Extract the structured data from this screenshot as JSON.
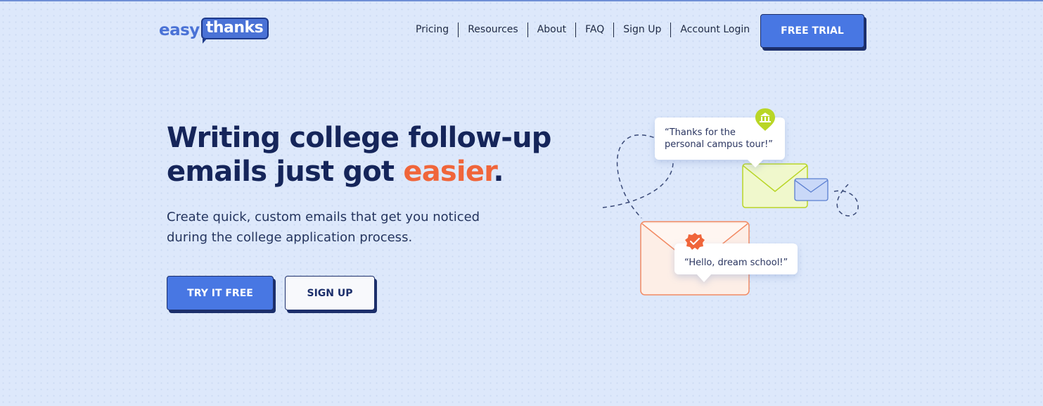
{
  "logo": {
    "part1": "easy",
    "part2": "thanks"
  },
  "nav": {
    "items": [
      "Pricing",
      "Resources",
      "About",
      "FAQ",
      "Sign Up",
      "Account Login"
    ],
    "cta_label": "FREE TRIAL"
  },
  "hero": {
    "headline_line1": "Writing college follow-up",
    "headline_line2_start": "emails just got ",
    "headline_accent": "easier",
    "headline_end": ".",
    "subtext": "Create quick, custom emails that get you noticed during the college application process.",
    "primary_button": "TRY IT FREE",
    "secondary_button": "SIGN UP"
  },
  "illustration": {
    "bubble_top_line1": "“Thanks for the",
    "bubble_top_line2": "personal campus tour!”",
    "bubble_bottom": "“Hello, dream school!”",
    "icons": [
      "institution-pin-icon",
      "green-envelope-icon",
      "blue-envelope-icon",
      "orange-envelope-icon",
      "check-badge-icon"
    ],
    "colors": {
      "accent_orange": "#f0653a",
      "primary_blue": "#4877e3",
      "navy": "#15255a",
      "lime": "#b9d627"
    }
  }
}
